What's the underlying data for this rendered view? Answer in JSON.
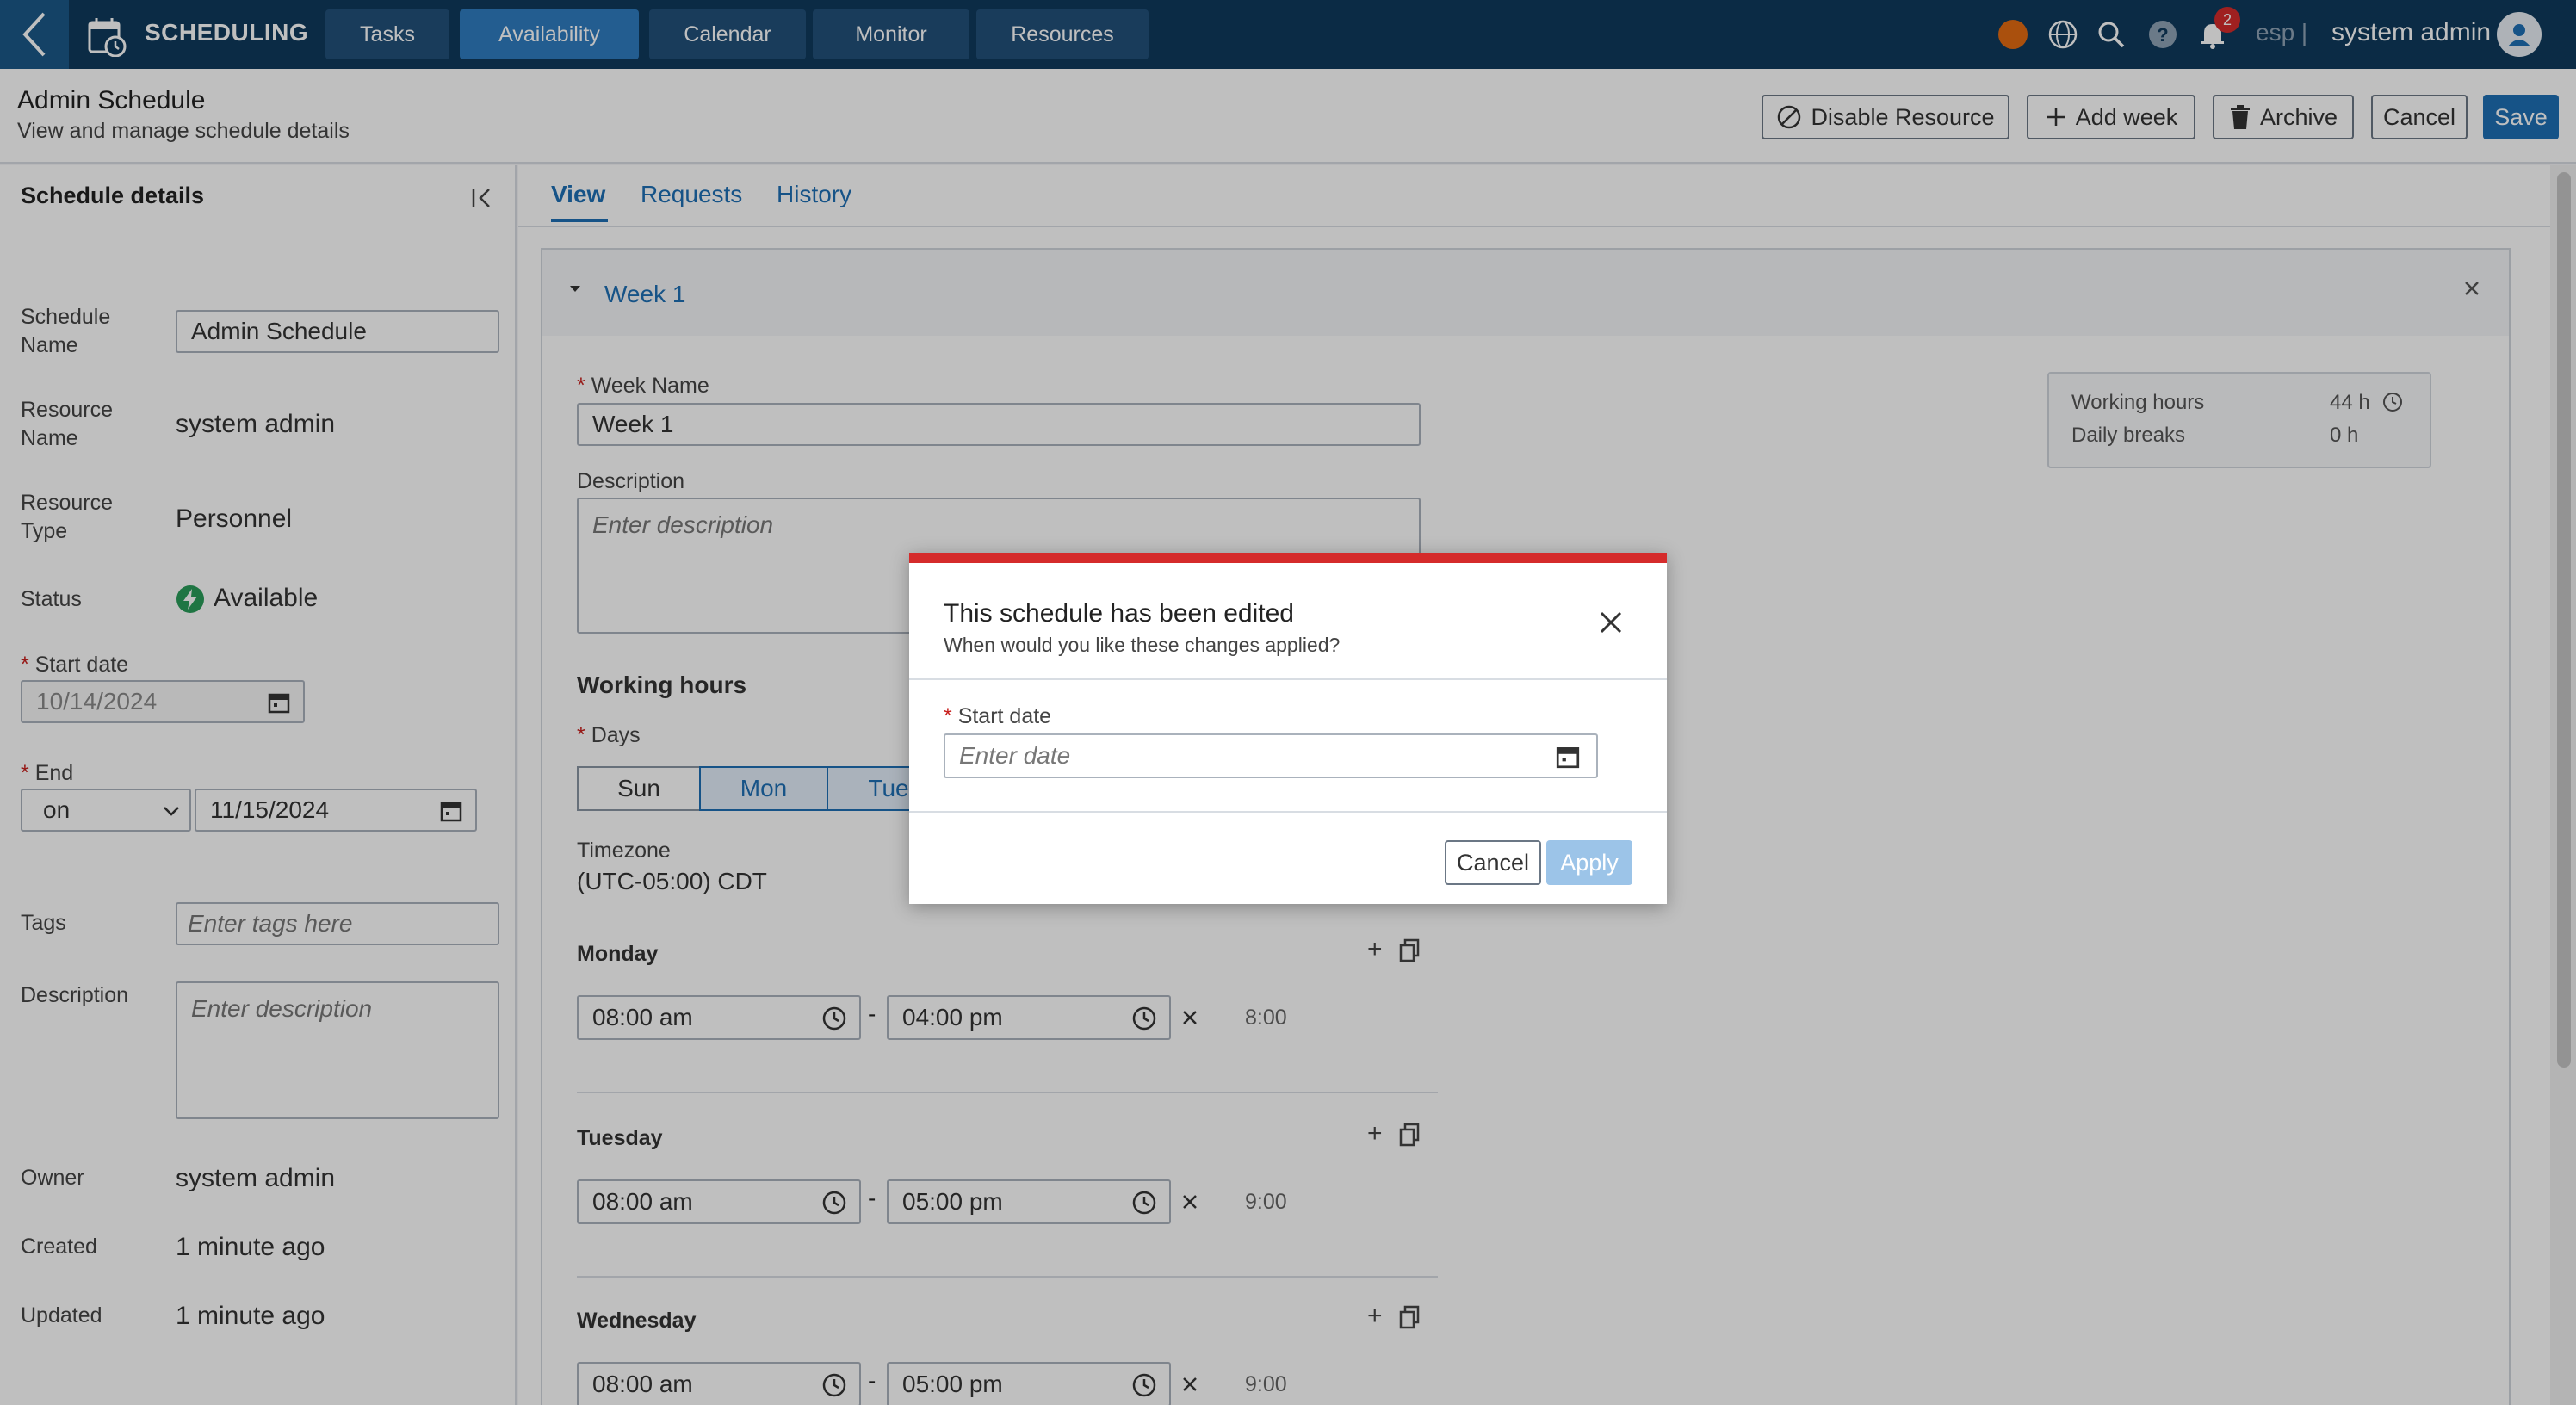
{
  "app": {
    "title": "SCHEDULING"
  },
  "nav": {
    "tabs": [
      {
        "label": "Tasks"
      },
      {
        "label": "Availability"
      },
      {
        "label": "Calendar"
      },
      {
        "label": "Monitor"
      },
      {
        "label": "Resources"
      }
    ]
  },
  "topbar": {
    "notification_count": "2",
    "language": "esp |",
    "user_name": "system admin",
    "status_color": "#e36b12"
  },
  "header": {
    "title": "Admin Schedule",
    "subtitle": "View and manage schedule details",
    "disable_label": "Disable Resource",
    "add_week_label": "Add week",
    "archive_label": "Archive",
    "cancel_label": "Cancel",
    "save_label": "Save"
  },
  "details": {
    "heading": "Schedule details",
    "schedule_name_label1": "Schedule",
    "schedule_name_label2": "Name",
    "schedule_name_value": "Admin Schedule",
    "resource_name_label1": "Resource",
    "resource_name_label2": "Name",
    "resource_name_value": "system admin",
    "resource_type_label1": "Resource",
    "resource_type_label2": "Type",
    "resource_type_value": "Personnel",
    "status_label": "Status",
    "status_value": "Available",
    "start_date_label": "Start date",
    "start_date_value": "10/14/2024",
    "end_label": "End",
    "end_mode": "on",
    "end_date_value": "11/15/2024",
    "tags_label": "Tags",
    "tags_placeholder": "Enter tags here",
    "description_label": "Description",
    "description_placeholder": "Enter description",
    "owner_label": "Owner",
    "owner_value": "system admin",
    "created_label": "Created",
    "created_value": "1 minute ago",
    "updated_label": "Updated",
    "updated_value": "1 minute ago"
  },
  "main_tabs": [
    {
      "label": "View"
    },
    {
      "label": "Requests"
    },
    {
      "label": "History"
    }
  ],
  "week": {
    "title": "Week 1",
    "name_label": "Week Name",
    "name_value": "Week 1",
    "description_label": "Description",
    "description_placeholder": "Enter description",
    "working_hours_label": "Working hours",
    "days_label": "Days",
    "days": [
      "Sun",
      "Mon",
      "Tue"
    ],
    "timezone_label": "Timezone",
    "timezone_value": "(UTC-05:00) CDT",
    "summary": {
      "working_hours_label": "Working hours",
      "working_hours_value": "44 h",
      "daily_breaks_label": "Daily breaks",
      "daily_breaks_value": "0 h"
    },
    "schedule": [
      {
        "day": "Monday",
        "start": "08:00 am",
        "end": "04:00 pm",
        "duration": "8:00"
      },
      {
        "day": "Tuesday",
        "start": "08:00 am",
        "end": "05:00 pm",
        "duration": "9:00"
      },
      {
        "day": "Wednesday",
        "start": "08:00 am",
        "end": "05:00 pm",
        "duration": "9:00"
      }
    ]
  },
  "dialog": {
    "title": "This schedule has been edited",
    "subtitle": "When would you like these changes applied?",
    "start_date_label": "Start date",
    "start_date_placeholder": "Enter date",
    "cancel_label": "Cancel",
    "apply_label": "Apply"
  }
}
